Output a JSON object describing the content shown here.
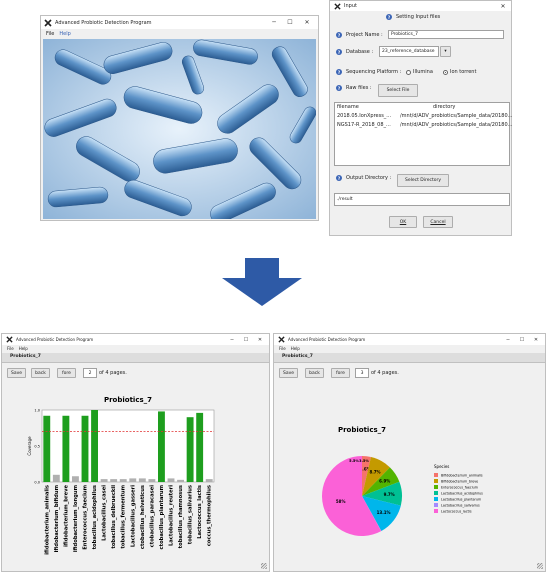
{
  "main_window": {
    "title": "Advanced Probiotic Detection Program",
    "menu": [
      "File",
      "Help"
    ]
  },
  "input_dialog": {
    "title": "Input",
    "header": "Setting Input files",
    "project_name_label": "Project Name :",
    "project_name_value": "Probiotics_7",
    "database_label": "Database :",
    "database_value": "23_reference_database",
    "platform_label": "Sequencing Platform :",
    "platform_options": [
      "Illumina",
      "Ion torrent"
    ],
    "platform_selected": "Ion torrent",
    "raw_files_label": "Raw files :",
    "select_file_btn": "Select File",
    "columns": [
      "filename",
      "directory"
    ],
    "files": [
      {
        "filename": "2018.05.IonXpress_...",
        "directory": "/mnt/d/ADV_probiotics/Sample_data/20180..."
      },
      {
        "filename": "NGS17-R_2018_08_...",
        "directory": "/mnt/d/ADV_probiotics/Sample_data/20180..."
      }
    ],
    "output_dir_label": "Output Directory :",
    "select_dir_btn": "Select Directory",
    "output_value": "./result",
    "ok_btn": "OK",
    "cancel_btn": "Cancel"
  },
  "bar_window": {
    "title": "Advanced Probiotic Detection Program",
    "menu": [
      "File",
      "Help"
    ],
    "tab": "Probiotics_7",
    "save_btn": "Save",
    "back_btn": "back",
    "fore_btn": "fore",
    "page_value": "2",
    "page_suffix": "of 4 pages."
  },
  "pie_window": {
    "title": "Advanced Probiotic Detection Program",
    "menu": [
      "File",
      "Help"
    ],
    "tab": "Probiotics_7",
    "save_btn": "Save",
    "back_btn": "back",
    "fore_btn": "fore",
    "page_value": "3",
    "page_suffix": "of 4 pages."
  },
  "colors": {
    "arrow": "#2e5aa6",
    "bar_green": "#1e9e1e",
    "bar_grey": "#b0b0b0",
    "threshold": "#e03030",
    "accent": "#3a64b5"
  },
  "chart_data": [
    {
      "type": "bar",
      "title": "Probiotics_7",
      "xlabel": "",
      "ylabel": "Coverage",
      "ylim": [
        0,
        1
      ],
      "yticks": [
        "0.0",
        "0.5",
        "1.0"
      ],
      "threshold": 0.7,
      "categories": [
        "Bifidobacterium_animalis",
        "Bifidobacterium_bifidum",
        "Bifidobacterium_breve",
        "Bifidobacterium_longum",
        "Enterococcus_faecium",
        "Lactobacillus_acidophilus",
        "Lactobacillus_casei",
        "Lactobacillus_delbrueckii",
        "Lactobacillus_fermentum",
        "Lactobacillus_gasseri",
        "Lactobacillus_helveticus",
        "Lactobacillus_paracasei",
        "Lactobacillus_plantarum",
        "Lactobacillus_reuteri",
        "Lactobacillus_rhamnosus",
        "Lactobacillus_salivarius",
        "Lactococcus_lactis",
        "Streptococcus_thermophilus"
      ],
      "tick_labels": [
        "ifidobacterium_animalis",
        "ifidobacterium_bifidum",
        "ifidobacterium_breve",
        "ifidobacterium_longum",
        "Enterococcus_faecium",
        "tobacillus_acidophilus",
        "Lactobacillus_casei",
        "tobacillus_delbrueckii",
        "tobacillus_fermentum",
        "Lactobacillus_gasseri",
        "ctobacillus_helveticus",
        "ctobacillus_paracasei",
        "ctobacillus_plantarum",
        "Lactobacillus_reuteri",
        "tobacillus_rhamnosus",
        "tobacillus_salivarius",
        "Lactococcus_lactis",
        "coccus_thermophilus"
      ],
      "values": [
        0.92,
        0.1,
        0.92,
        0.08,
        0.92,
        1.0,
        0.04,
        0.04,
        0.04,
        0.05,
        0.05,
        0.04,
        0.98,
        0.05,
        0.03,
        0.9,
        0.96,
        0.04
      ],
      "colors": [
        "#1e9e1e",
        "#b0b0b0",
        "#1e9e1e",
        "#b0b0b0",
        "#1e9e1e",
        "#1e9e1e",
        "#b0b0b0",
        "#b0b0b0",
        "#b0b0b0",
        "#b0b0b0",
        "#b0b0b0",
        "#b0b0b0",
        "#1e9e1e",
        "#b0b0b0",
        "#b0b0b0",
        "#1e9e1e",
        "#1e9e1e",
        "#b0b0b0"
      ]
    },
    {
      "type": "pie",
      "title": "Probiotics_7",
      "legend_title": "Species",
      "legend_position": "right",
      "slices": [
        {
          "label": "Bifidobacterium_animalis",
          "value": 3.6,
          "text": "3.6%",
          "color": "#f5736b"
        },
        {
          "label": "Bifidobacterium_breve",
          "value": 8.7,
          "text": "8.7%",
          "color": "#c49a00"
        },
        {
          "label": "Enterococcus_faecium",
          "value": 6.9,
          "text": "6.9%",
          "color": "#53b400"
        },
        {
          "label": "Lactobacillus_acidophilus",
          "value": 9.7,
          "text": "9.7%",
          "color": "#00c094"
        },
        {
          "label": "Lactobacillus_plantarum",
          "value": 13.1,
          "text": "13.1%",
          "color": "#00b6eb"
        },
        {
          "label": "Lactobacillus_salivarius",
          "value": 0.1,
          "text": "",
          "color": "#a58aff"
        },
        {
          "label": "Lactococcus_lactis",
          "value": 58,
          "text": "58%",
          "color": "#fb61d7"
        }
      ],
      "extra_labels": [
        "5.5%",
        "3.5%"
      ]
    }
  ]
}
